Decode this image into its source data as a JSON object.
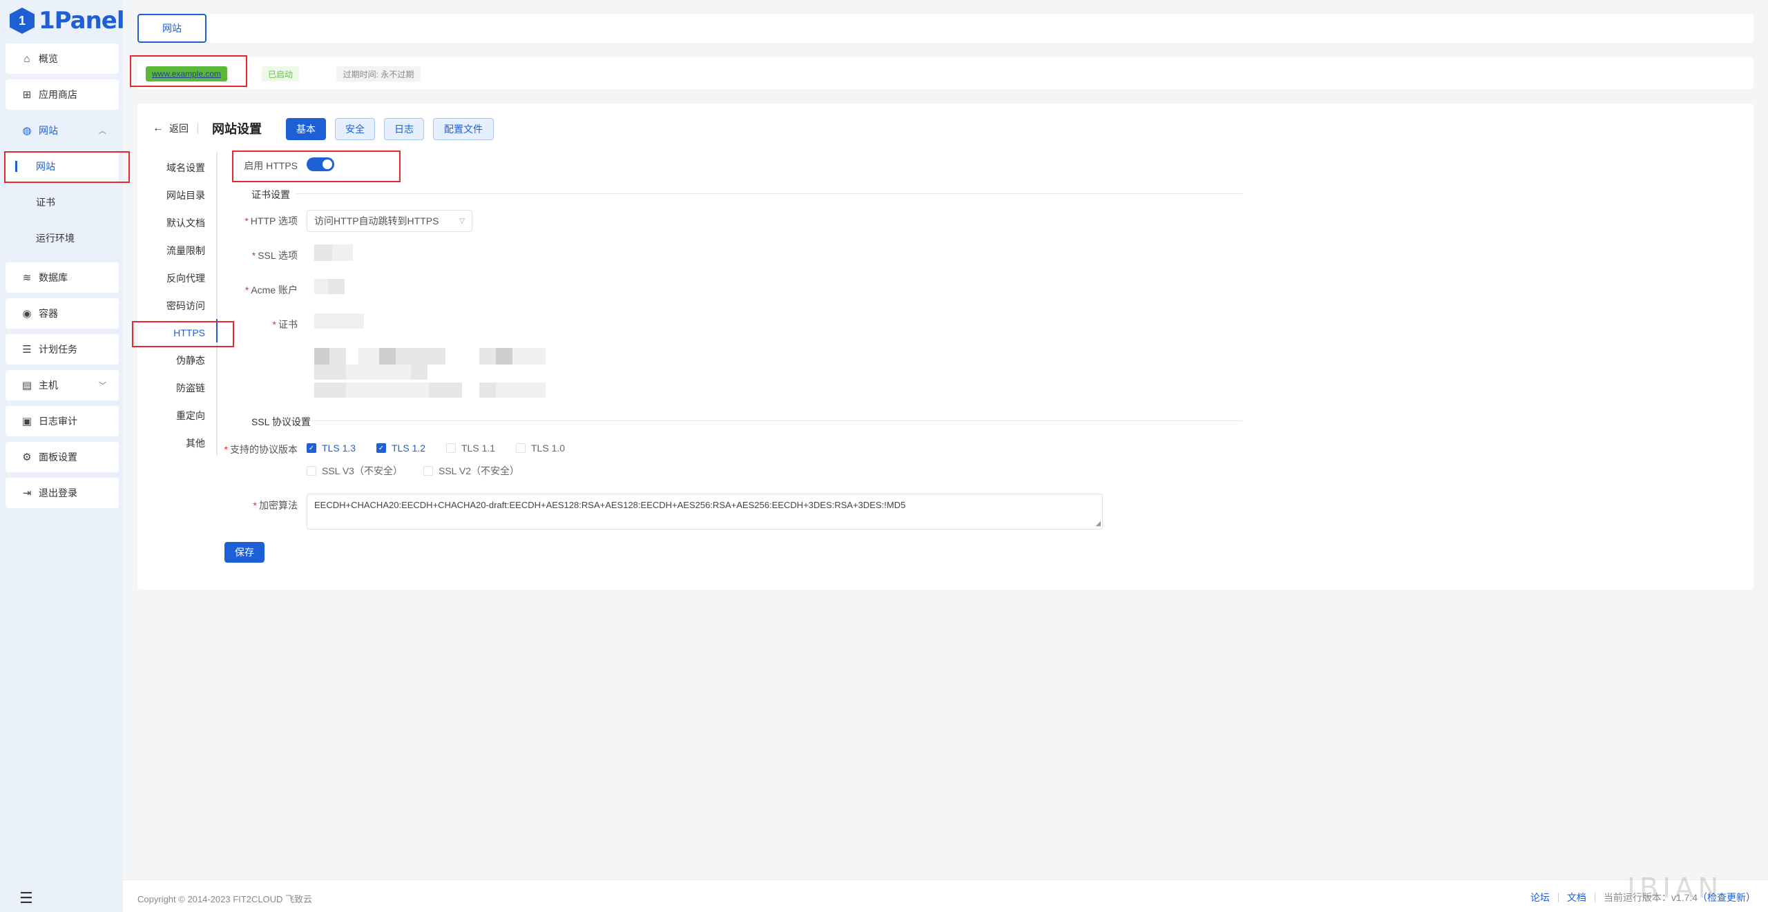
{
  "brand": {
    "logo_mark": "1",
    "name": "1Panel",
    "color": "#1f5fd6"
  },
  "sidebar": {
    "items": [
      {
        "label": "概览",
        "icon": "home-icon"
      },
      {
        "label": "应用商店",
        "icon": "grid-icon"
      },
      {
        "label": "网站",
        "icon": "globe-icon"
      },
      {
        "label": "数据库",
        "icon": "layers-icon"
      },
      {
        "label": "容器",
        "icon": "docker-icon"
      },
      {
        "label": "计划任务",
        "icon": "list-icon"
      },
      {
        "label": "主机",
        "icon": "server-icon"
      },
      {
        "label": "日志审计",
        "icon": "log-icon"
      },
      {
        "label": "面板设置",
        "icon": "gear-icon"
      },
      {
        "label": "退出登录",
        "icon": "logout-icon"
      }
    ],
    "website_submenu": [
      {
        "label": "网站"
      },
      {
        "label": "证书"
      },
      {
        "label": "运行环境"
      }
    ]
  },
  "tabbar": {
    "tab_label": "网站"
  },
  "site": {
    "domain": "www.example.com",
    "status": "已启动",
    "expire": "过期时间: 永不过期"
  },
  "header": {
    "back": "返回",
    "title": "网站设置",
    "tabs": [
      "基本",
      "安全",
      "日志",
      "配置文件"
    ]
  },
  "side_nav": [
    "域名设置",
    "网站目录",
    "默认文档",
    "流量限制",
    "反向代理",
    "密码访问",
    "HTTPS",
    "伪静态",
    "防盗链",
    "重定向",
    "其他"
  ],
  "form": {
    "enable_https_label": "启用 HTTPS",
    "cert_section": "证书设置",
    "http_option_label": "HTTP 选项",
    "http_option_value": "访问HTTP自动跳转到HTTPS",
    "ssl_option_label": "SSL 选项",
    "acme_label": "Acme 账户",
    "cert_label": "证书",
    "ssl_section": "SSL 协议设置",
    "protocol_label": "支持的协议版本",
    "protocols": [
      {
        "label": "TLS 1.3",
        "checked": true
      },
      {
        "label": "TLS 1.2",
        "checked": true
      },
      {
        "label": "TLS 1.1",
        "checked": false
      },
      {
        "label": "TLS 1.0",
        "checked": false
      },
      {
        "label": "SSL V3（不安全）",
        "checked": false
      },
      {
        "label": "SSL V2（不安全）",
        "checked": false
      }
    ],
    "cipher_label": "加密算法",
    "cipher_value": "EECDH+CHACHA20:EECDH+CHACHA20-draft:EECDH+AES128:RSA+AES128:EECDH+AES256:RSA+AES256:EECDH+3DES:RSA+3DES:!MD5",
    "save": "保存"
  },
  "footer": {
    "copyright": "Copyright © 2014-2023 FIT2CLOUD 飞致云",
    "forum": "论坛",
    "docs": "文档",
    "version_prefix": "当前运行版本：",
    "version": "v1.7.4",
    "check_update": "（检查更新）"
  },
  "watermark": "IBIAN",
  "colors": {
    "primary": "#1f5fd6",
    "success": "#5cb937",
    "annotation": "#e8262e"
  }
}
